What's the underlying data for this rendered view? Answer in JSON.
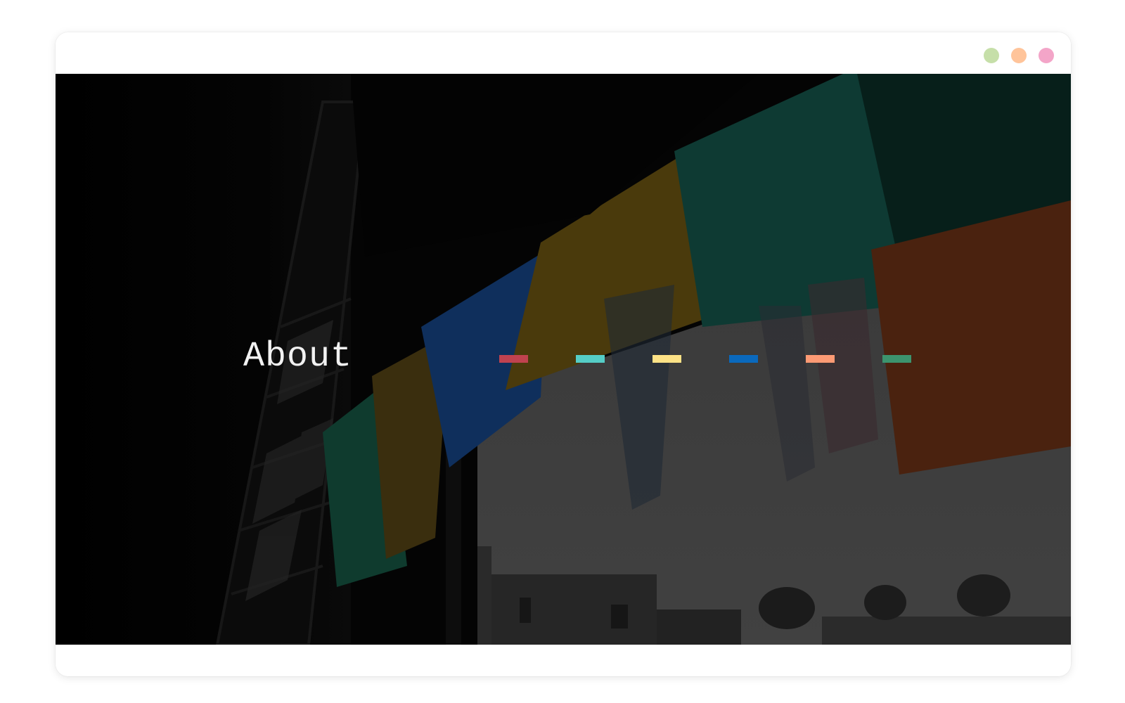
{
  "window": {
    "controls": [
      {
        "name": "green",
        "color": "#c6dfa9"
      },
      {
        "name": "orange",
        "color": "#ffc49a"
      },
      {
        "name": "pink",
        "color": "#f3a5c8"
      }
    ]
  },
  "hero": {
    "title": "About",
    "color_bars": [
      {
        "color": "#c0424f"
      },
      {
        "color": "#55cdc6"
      },
      {
        "color": "#fde286"
      },
      {
        "color": "#0a69bd"
      },
      {
        "color": "#fd9a74"
      },
      {
        "color": "#3c946e"
      }
    ]
  }
}
